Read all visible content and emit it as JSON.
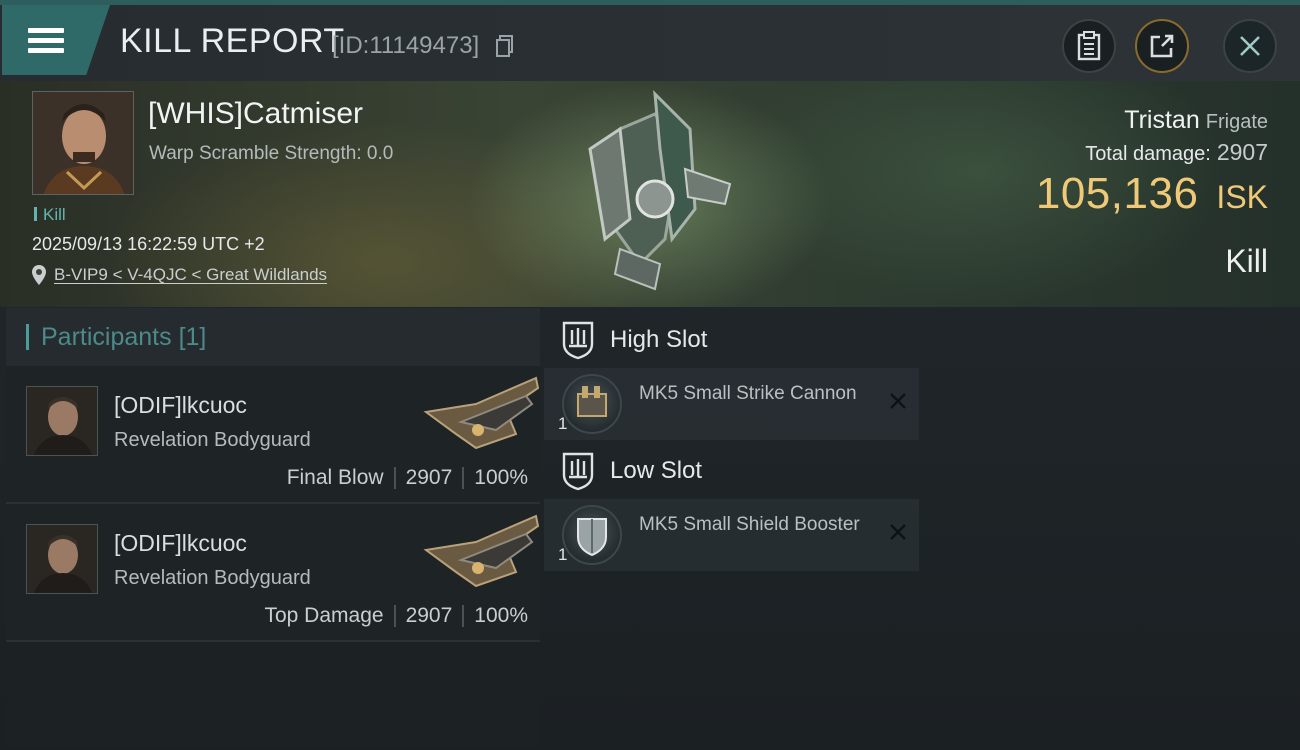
{
  "header": {
    "title": "KILL REPORT",
    "report_id": "[ID:11149473]"
  },
  "victim": {
    "name": "[WHIS]Catmiser",
    "warp_scramble": "Warp Scramble Strength: 0.0",
    "tag": "Kill",
    "datetime": "2025/09/13 16:22:59 UTC +2",
    "location": "B-VIP9 < V-4QJC < Great Wildlands",
    "ship_name": "Tristan",
    "ship_class": "Frigate",
    "total_damage_label": "Total damage:",
    "total_damage_value": "2907",
    "isk_value": "105,136",
    "isk_currency": "ISK",
    "kill_type": "Kill"
  },
  "participants": {
    "header_label": "Participants",
    "header_count": "[1]",
    "rows": [
      {
        "name": "[ODIF]lkcuoc",
        "ship": "Revelation Bodyguard",
        "role": "Final Blow",
        "damage": "2907",
        "percent": "100%"
      },
      {
        "name": "[ODIF]lkcuoc",
        "ship": "Revelation Bodyguard",
        "role": "Top Damage",
        "damage": "2907",
        "percent": "100%"
      }
    ]
  },
  "fitting": {
    "high_slot_label": "High Slot",
    "low_slot_label": "Low Slot",
    "high_modules": [
      {
        "qty": "1",
        "name": "MK5 Small Strike Cannon"
      }
    ],
    "low_modules": [
      {
        "qty": "1",
        "name": "MK5 Small Shield Booster"
      }
    ]
  },
  "colors": {
    "accent_teal": "#2f6a69",
    "isk_gold": "#efc978"
  }
}
